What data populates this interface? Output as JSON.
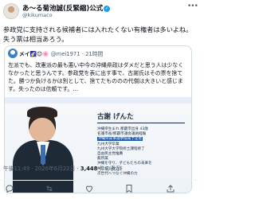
{
  "author": {
    "display_name": "あ〜る菊池誠(反緊縮)公式",
    "handle": "@kikumaco",
    "verified": true,
    "avatar": "avatar-photo"
  },
  "icons": {
    "verified": "verified-badge-icon",
    "more": "more-options-icon",
    "reply": "reply-icon",
    "retweet": "retweet-icon",
    "like": "like-icon",
    "bookmark": "bookmark-icon",
    "share": "share-icon"
  },
  "tweet": {
    "text": "参政党に支持される候補者には入れたくない有権者は多いよね。失う票は相当あろう。"
  },
  "quote": {
    "author_name": "メイ🌠😊🌸",
    "author_handle": "@mei1971",
    "date": "21時間",
    "text": "左派でも、改憲派の最も悪い中今の沖縄県政はダメだと思う人は少なくなかったと思うんです。参政党を表に出す事で、古謝氏はその票を捨てた。勝つか負けるかは別として、捨てたもののの代償は大きいと感じます。失ったのは信頼です。…",
    "poster": {
      "candidate_name": "古謝 げんた",
      "details": [
        "沖縄県生まれ 那覇市出身 43歳",
        "名護市長/那覇市議会議員経験",
        "九州大学卒業",
        "九州大学大学院修士課程修了",
        "自由民主党推薦",
        "無所属",
        "沖縄を守り、子どもたちの未来を",
        "共に描く政治を",
        "次世代へつなぐ沖縄の力"
      ],
      "badge": "沖縄県知事選挙候補予定者"
    }
  },
  "meta": {
    "time": "午後11:49",
    "date": "2026年6月22日",
    "views": "3,448",
    "views_label": "件の表示"
  }
}
